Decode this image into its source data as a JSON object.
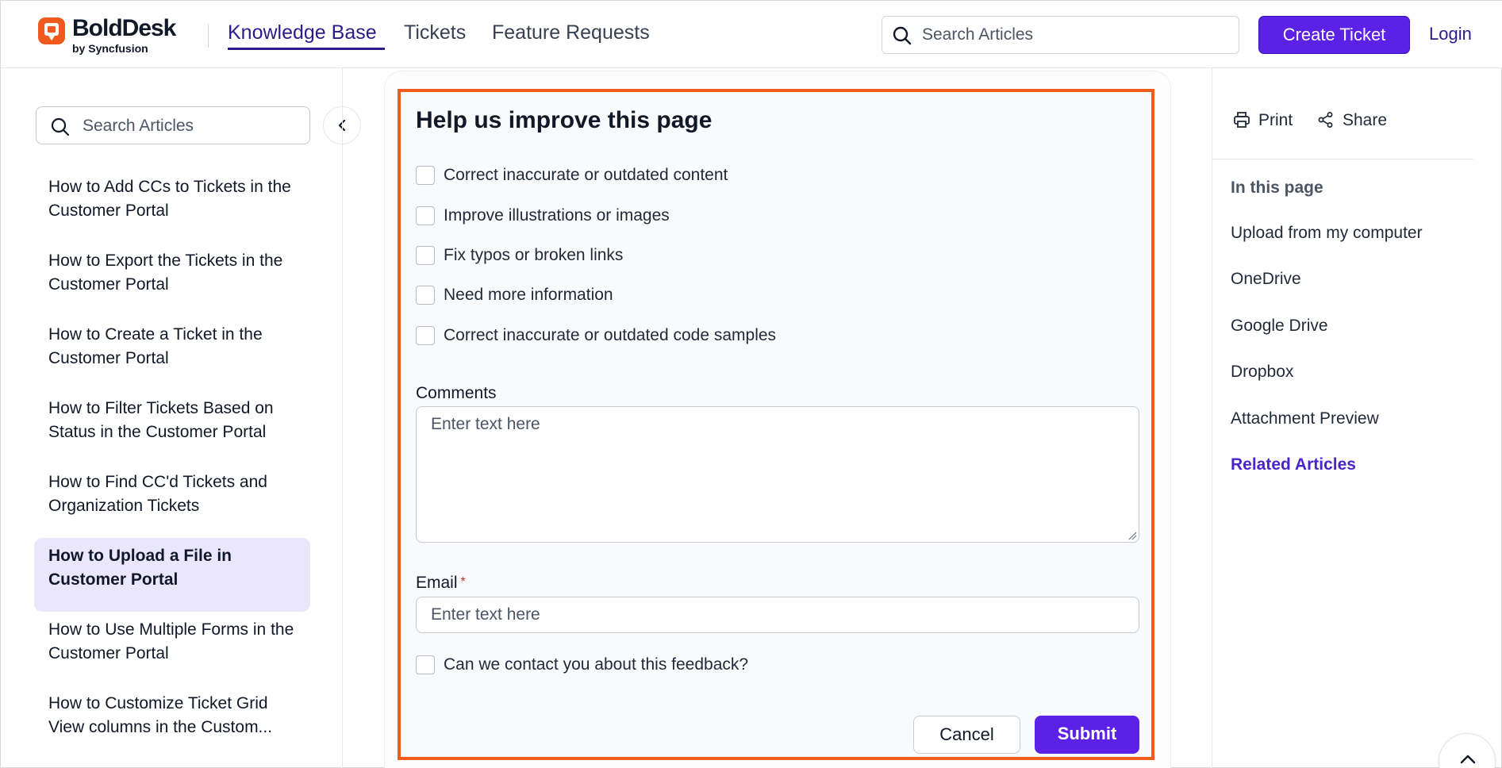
{
  "brand": {
    "name": "BoldDesk",
    "sub": "by Syncfusion",
    "accent": "#f05a1c",
    "primary": "#5b21e6"
  },
  "nav": {
    "items": [
      "Knowledge Base",
      "Tickets",
      "Feature Requests"
    ],
    "active": "Knowledge Base"
  },
  "header": {
    "search_placeholder": "Search Articles",
    "create_ticket": "Create Ticket",
    "login": "Login"
  },
  "sidebar": {
    "search_placeholder": "Search Articles",
    "collapse_icon": "chevron-left-icon",
    "items": [
      {
        "label": "How to Add CCs to Tickets in the Customer Portal",
        "active": false
      },
      {
        "label": "How to Export the Tickets in the Customer Portal",
        "active": false
      },
      {
        "label": "How to Create a Ticket in the Customer Portal",
        "active": false
      },
      {
        "label": "How to Filter Tickets Based on Status in the Customer Portal",
        "active": false
      },
      {
        "label": "How to Find CC'd Tickets and Organization Tickets",
        "active": false
      },
      {
        "label": "How to Upload a File in Customer Portal",
        "active": true
      },
      {
        "label": "How to Use Multiple Forms in the Customer Portal",
        "active": false
      },
      {
        "label": "How to Customize Ticket Grid View columns in the Custom...",
        "active": false
      }
    ]
  },
  "feedback": {
    "title": "Help us improve this page",
    "options": [
      "Correct inaccurate or outdated content",
      "Improve illustrations or images",
      "Fix typos or broken links",
      "Need more information",
      "Correct inaccurate or outdated code samples"
    ],
    "comments_label": "Comments",
    "comments_placeholder": "Enter text here",
    "email_label": "Email",
    "email_required_mark": "*",
    "email_placeholder": "Enter text here",
    "contact_label": "Can we contact you about this feedback?",
    "cancel": "Cancel",
    "submit": "Submit"
  },
  "right_panel": {
    "print": "Print",
    "share": "Share",
    "toc_title": "In this page",
    "toc": [
      {
        "label": "Upload from my computer",
        "accent": false
      },
      {
        "label": "OneDrive",
        "accent": false
      },
      {
        "label": "Google Drive",
        "accent": false
      },
      {
        "label": "Dropbox",
        "accent": false
      },
      {
        "label": "Attachment Preview",
        "accent": false
      },
      {
        "label": "Related Articles",
        "accent": true
      }
    ]
  }
}
